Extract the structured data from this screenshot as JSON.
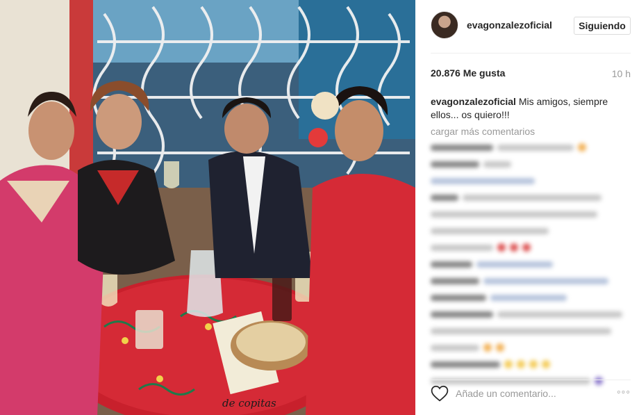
{
  "post": {
    "username": "evagonzalezoficial",
    "follow_label": "Siguiendo",
    "likes": "20.876 Me gusta",
    "time": "10 h",
    "caption": {
      "user": "evagonzalezoficial",
      "text": "Mis amigos, siempre ellos... os quiero!!!"
    },
    "load_more": "cargar más comentarios",
    "comment_placeholder": "Añade un comentario...",
    "more_label": "◦◦◦",
    "table_text": "de copitas"
  },
  "colors": {
    "accent_red": "#d52a36",
    "link_blue": "#003569",
    "muted": "#999999",
    "border": "#dbdbdb"
  },
  "icons": [
    "heart-icon",
    "more-options-icon",
    "avatar"
  ]
}
